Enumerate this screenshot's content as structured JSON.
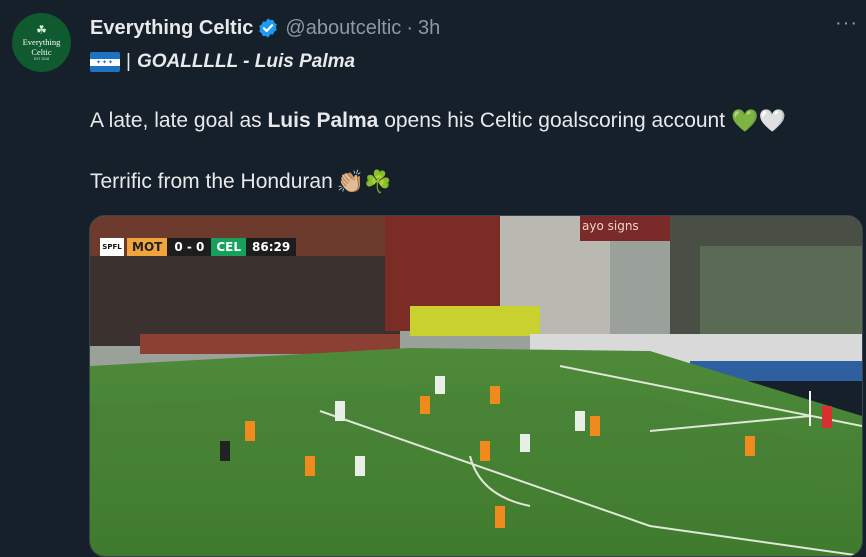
{
  "author": {
    "avatar_text": "Everything Celtic",
    "avatar_sub": "EST 2018",
    "display_name": "Everything Celtic",
    "handle": "@aboutceltic",
    "separator": "·",
    "time": "3h",
    "verified_icon": "verified-badge-icon"
  },
  "more_label": "···",
  "headline": {
    "flag_icon": "honduras-flag-icon",
    "separator": "|",
    "text": "GOALLLLL - Luis Palma"
  },
  "body": {
    "line1_pre": "A late, late goal as",
    "line1_bold": "Luis Palma",
    "line1_post": "opens his Celtic goalscoring account",
    "line1_emoji": "💚🤍",
    "line2_text": "Terrific from the Honduran",
    "line2_emoji": "👏🏼☘️"
  },
  "media": {
    "scoreboard": {
      "team1": "MOT",
      "score": "0 - 0",
      "team2": "CEL",
      "clock": "86:29"
    },
    "sponsor_text": "ayo signs"
  },
  "colors": {
    "background": "#15202b",
    "verified": "#1d9bf0",
    "secondary_text": "#8b98a5"
  }
}
